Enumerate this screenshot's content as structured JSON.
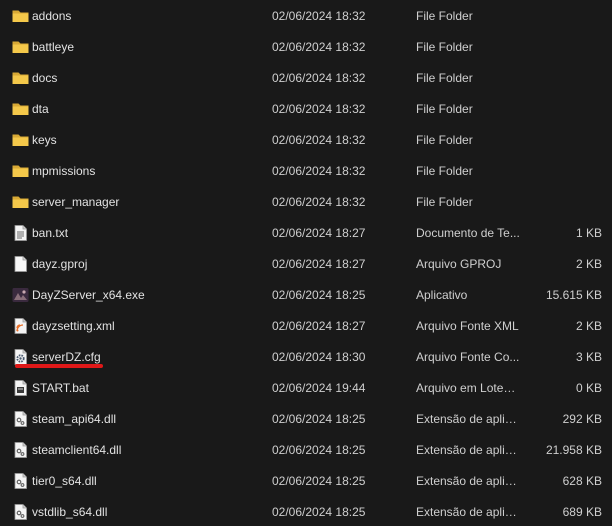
{
  "files": [
    {
      "name": "addons",
      "date": "02/06/2024 18:32",
      "type": "File Folder",
      "size": "",
      "icon": "folder-icon"
    },
    {
      "name": "battleye",
      "date": "02/06/2024 18:32",
      "type": "File Folder",
      "size": "",
      "icon": "folder-icon"
    },
    {
      "name": "docs",
      "date": "02/06/2024 18:32",
      "type": "File Folder",
      "size": "",
      "icon": "folder-icon"
    },
    {
      "name": "dta",
      "date": "02/06/2024 18:32",
      "type": "File Folder",
      "size": "",
      "icon": "folder-icon"
    },
    {
      "name": "keys",
      "date": "02/06/2024 18:32",
      "type": "File Folder",
      "size": "",
      "icon": "folder-icon"
    },
    {
      "name": "mpmissions",
      "date": "02/06/2024 18:32",
      "type": "File Folder",
      "size": "",
      "icon": "folder-icon"
    },
    {
      "name": "server_manager",
      "date": "02/06/2024 18:32",
      "type": "File Folder",
      "size": "",
      "icon": "folder-icon"
    },
    {
      "name": "ban.txt",
      "date": "02/06/2024 18:27",
      "type": "Documento de Te...",
      "size": "1 KB",
      "icon": "text-file-icon"
    },
    {
      "name": "dayz.gproj",
      "date": "02/06/2024 18:27",
      "type": "Arquivo GPROJ",
      "size": "2 KB",
      "icon": "blank-file-icon"
    },
    {
      "name": "DayZServer_x64.exe",
      "date": "02/06/2024 18:25",
      "type": "Aplicativo",
      "size": "15.615 KB",
      "icon": "exe-icon"
    },
    {
      "name": "dayzsetting.xml",
      "date": "02/06/2024 18:27",
      "type": "Arquivo Fonte XML",
      "size": "2 KB",
      "icon": "xml-file-icon"
    },
    {
      "name": "serverDZ.cfg",
      "date": "02/06/2024 18:30",
      "type": "Arquivo Fonte Co...",
      "size": "3 KB",
      "icon": "config-file-icon"
    },
    {
      "name": "START.bat",
      "date": "02/06/2024 19:44",
      "type": "Arquivo em Lotes ...",
      "size": "0 KB",
      "icon": "batch-file-icon"
    },
    {
      "name": "steam_api64.dll",
      "date": "02/06/2024 18:25",
      "type": "Extensão de aplica...",
      "size": "292 KB",
      "icon": "dll-file-icon"
    },
    {
      "name": "steamclient64.dll",
      "date": "02/06/2024 18:25",
      "type": "Extensão de aplica...",
      "size": "21.958 KB",
      "icon": "dll-file-icon"
    },
    {
      "name": "tier0_s64.dll",
      "date": "02/06/2024 18:25",
      "type": "Extensão de aplica...",
      "size": "628 KB",
      "icon": "dll-file-icon"
    },
    {
      "name": "vstdlib_s64.dll",
      "date": "02/06/2024 18:25",
      "type": "Extensão de aplica...",
      "size": "689 KB",
      "icon": "dll-file-icon"
    }
  ],
  "colors": {
    "background": "#191919",
    "folder": "#f2c94c",
    "highlight_underline": "#e01818"
  }
}
